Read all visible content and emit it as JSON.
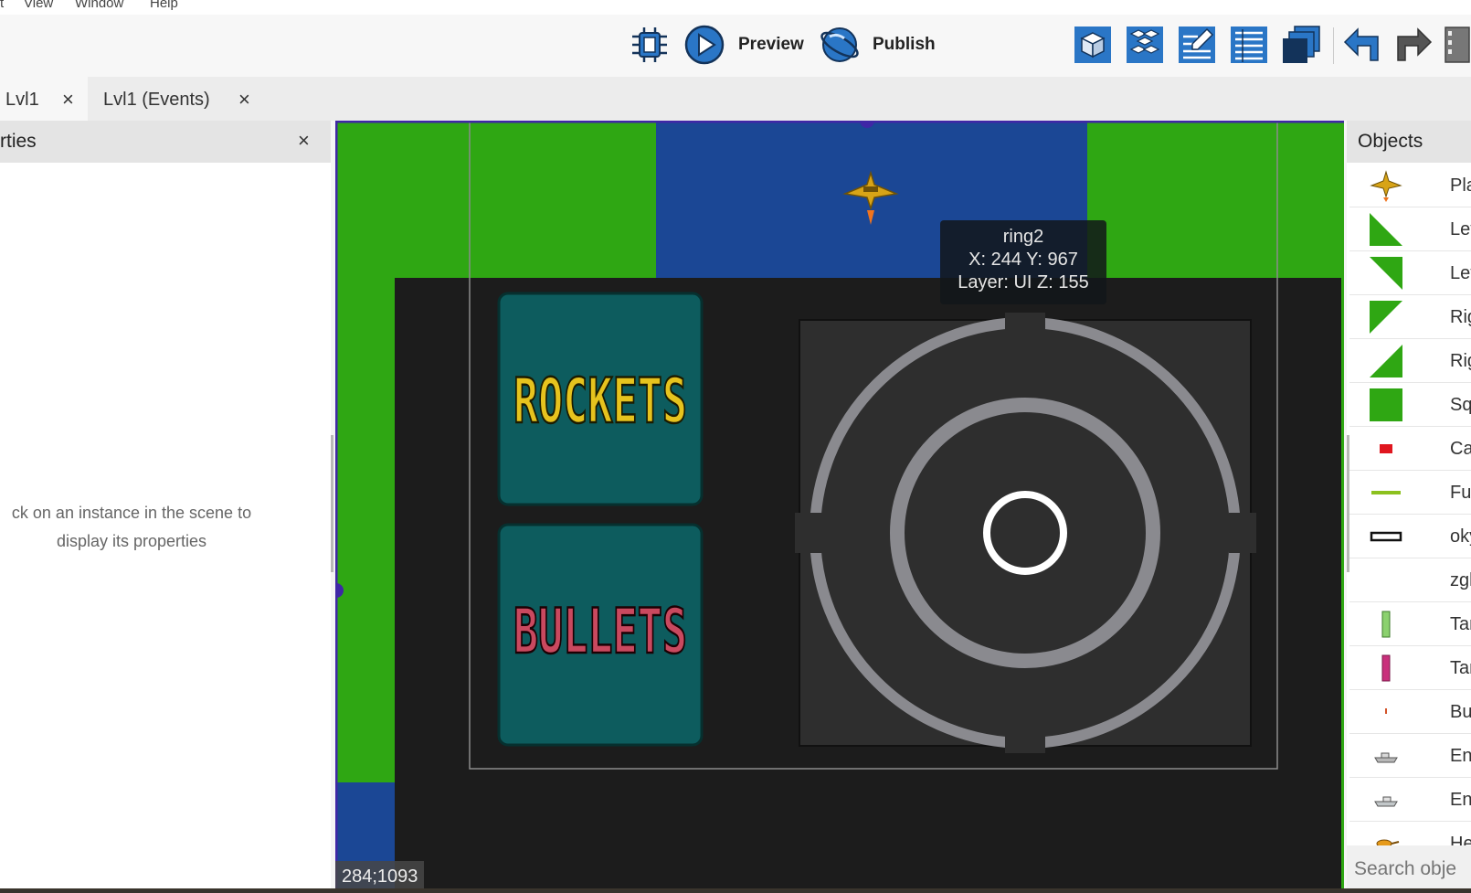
{
  "menu": {
    "items": [
      "t",
      "View",
      "Window",
      "Help"
    ]
  },
  "toolbar": {
    "preview_label": "Preview",
    "publish_label": "Publish"
  },
  "tabs": [
    {
      "label": "Lvl1",
      "close": "×"
    },
    {
      "label": "Lvl1 (Events)",
      "close": "×"
    }
  ],
  "properties_panel": {
    "title": "rties",
    "close": "×",
    "empty_line1": "ck on an instance in the scene to",
    "empty_line2": "display its properties"
  },
  "scene": {
    "coordinates": "284;1093",
    "rockets_label": "ROCKETS",
    "bullets_label": "BULLETS",
    "tooltip": {
      "name": "ring2",
      "position": "X: 244  Y: 967",
      "layer": "Layer: UI  Z: 155"
    }
  },
  "objects_panel": {
    "title": "Objects",
    "items": [
      {
        "label": "Pla",
        "icon": "plane-icon"
      },
      {
        "label": "Let",
        "icon": "left-slope-up-icon"
      },
      {
        "label": "Let",
        "icon": "left-slope-down-icon"
      },
      {
        "label": "Rig",
        "icon": "right-slope-down-icon"
      },
      {
        "label": "Rig",
        "icon": "right-slope-up-icon"
      },
      {
        "label": "Sq",
        "icon": "green-square-icon"
      },
      {
        "label": "Ca",
        "icon": "red-small-rect-icon"
      },
      {
        "label": "Fue",
        "icon": "green-line-icon"
      },
      {
        "label": "oky",
        "icon": "outlined-bar-icon"
      },
      {
        "label": "zgl",
        "icon": "blank-icon"
      },
      {
        "label": "Tar",
        "icon": "green-bar-icon"
      },
      {
        "label": "Tar",
        "icon": "pink-bar-icon"
      },
      {
        "label": "Bu",
        "icon": "bullet-icon"
      },
      {
        "label": "Ene",
        "icon": "enemy-ship-icon"
      },
      {
        "label": "Ene",
        "icon": "enemy-ship-2-icon"
      },
      {
        "label": "He",
        "icon": "helicopter-icon"
      }
    ],
    "search_placeholder": "Search obje"
  },
  "colors": {
    "grass": "#2fa713",
    "water": "#1b4795",
    "hud_bg": "#1c1c1c",
    "button_teal": "#0d5c5e",
    "rockets_text": "#e6c31e",
    "bullets_text": "#c9495f",
    "ring_gray": "#8a8a8f",
    "selection": "#3f27a6"
  }
}
